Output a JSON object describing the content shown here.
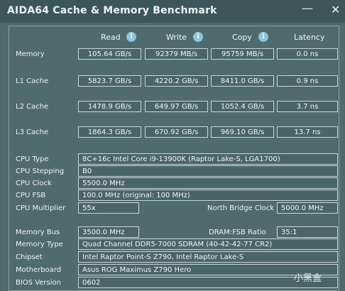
{
  "window": {
    "title": "AIDA64 Cache & Memory Benchmark",
    "minimize": "—",
    "close": "✕"
  },
  "columns": {
    "read": "Read",
    "write": "Write",
    "copy": "Copy",
    "latency": "Latency"
  },
  "rows": [
    {
      "label": "Memory",
      "read": "105.64 GB/s",
      "write": "92379 MB/s",
      "copy": "95759 MB/s",
      "latency": "0.0 ns"
    },
    {
      "label": "L1 Cache",
      "read": "5823.7 GB/s",
      "write": "4220.2 GB/s",
      "copy": "8411.0 GB/s",
      "latency": "0.9 ns"
    },
    {
      "label": "L2 Cache",
      "read": "1478.9 GB/s",
      "write": "649.97 GB/s",
      "copy": "1052.4 GB/s",
      "latency": "3.7 ns"
    },
    {
      "label": "L3 Cache",
      "read": "1864.3 GB/s",
      "write": "670.92 GB/s",
      "copy": "969.10 GB/s",
      "latency": "13.7 ns"
    }
  ],
  "cpu": {
    "type_label": "CPU Type",
    "type": "8C+16c Intel Core i9-13900K  (Raptor Lake-S, LGA1700)",
    "stepping_label": "CPU Stepping",
    "stepping": "B0",
    "clock_label": "CPU Clock",
    "clock": "5500.0 MHz",
    "fsb_label": "CPU FSB",
    "fsb": "100.0 MHz  (original: 100 MHz)",
    "multiplier_label": "CPU Multiplier",
    "multiplier": "55x",
    "nb_clock_label": "North Bridge Clock",
    "nb_clock": "5000.0 MHz"
  },
  "memory": {
    "bus_label": "Memory Bus",
    "bus": "3500.0 MHz",
    "ratio_label": "DRAM:FSB Ratio",
    "ratio": "35:1",
    "type_label": "Memory Type",
    "type": "Quad Channel DDR5-7000 SDRAM  (40-42-42-77 CR2)",
    "chipset_label": "Chipset",
    "chipset": "Intel Raptor Point-S Z790, Intel Raptor Lake-S",
    "motherboard_label": "Motherboard",
    "motherboard": "Asus ROG Maximus Z790 Hero",
    "bios_label": "BIOS Version",
    "bios": "0602"
  },
  "watermark": "小黑盒",
  "icons": {
    "info": "info-icon",
    "minimize": "minimize-icon",
    "close": "close-icon"
  },
  "colors": {
    "background": "#4f6b6e",
    "titlebar": "#3c5659",
    "info_icon": "#8fc3dc"
  }
}
